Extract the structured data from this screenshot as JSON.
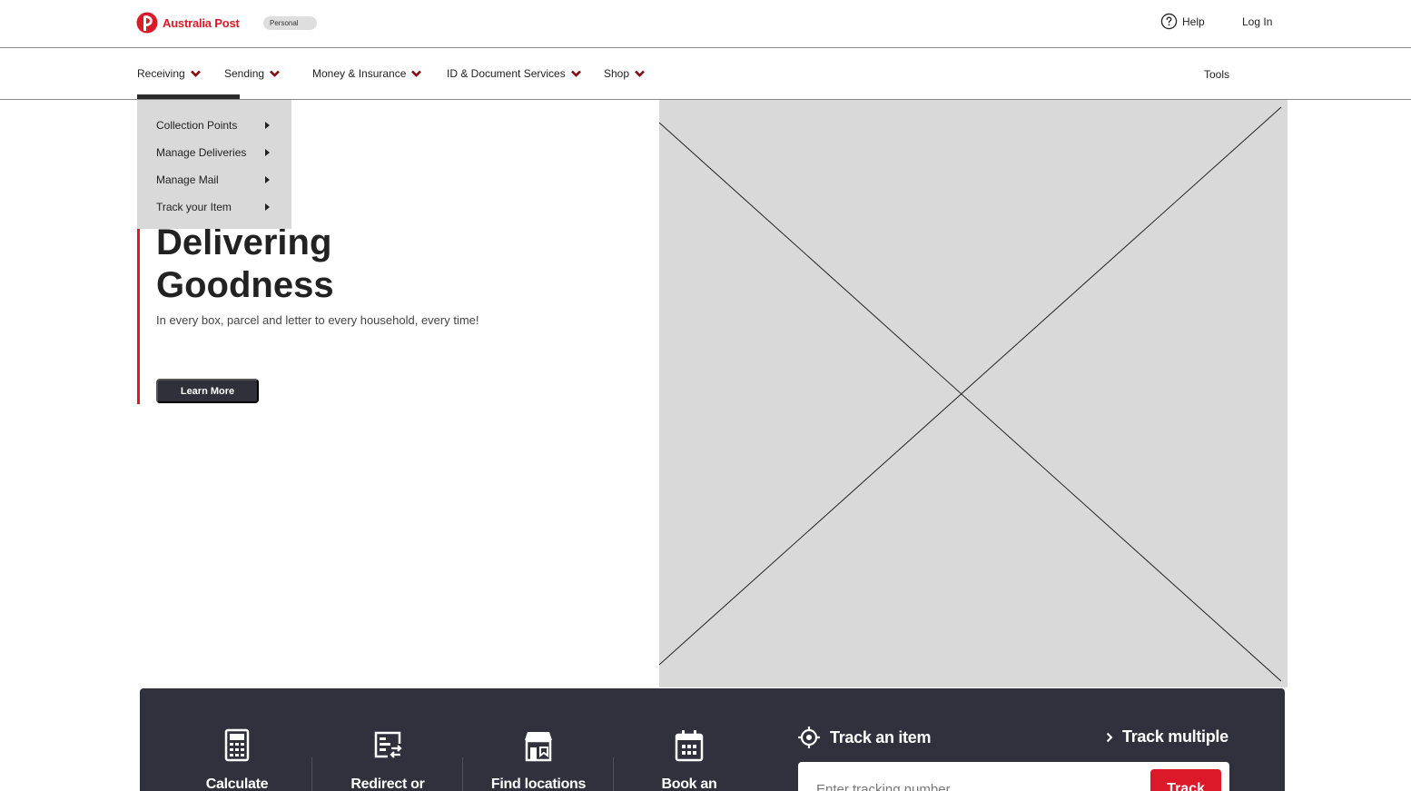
{
  "header": {
    "brand": "Australia Post",
    "persona": "Personal",
    "help_label": "Help",
    "login_label": "Log In",
    "brand_color": "#dc1928"
  },
  "nav": {
    "items": [
      {
        "label": "Receiving",
        "active": true
      },
      {
        "label": "Sending"
      },
      {
        "label": "Money & Insurance"
      },
      {
        "label": "ID & Document Services"
      },
      {
        "label": "Shop"
      }
    ],
    "tools_label": "Tools"
  },
  "dropdown": {
    "items": [
      {
        "label": "Collection Points"
      },
      {
        "label": "Manage Deliveries"
      },
      {
        "label": "Manage Mail"
      },
      {
        "label": "Track your Item"
      }
    ]
  },
  "hero": {
    "title_line1": "Delivering",
    "title_line2": "Goodness",
    "subtitle": "In every box, parcel and letter to every household, every time!",
    "cta_label": "Learn More"
  },
  "quick_actions": {
    "items": [
      {
        "label": "Calculate",
        "icon": "calculator-icon"
      },
      {
        "label": "Redirect or",
        "icon": "redirect-icon"
      },
      {
        "label": "Find locations",
        "icon": "post-office-icon"
      },
      {
        "label": "Book an",
        "icon": "calendar-icon"
      }
    ],
    "track": {
      "title": "Track an item",
      "multiple_label": "Track multiple",
      "input_placeholder": "Enter tracking number",
      "button_label": "Track"
    }
  }
}
